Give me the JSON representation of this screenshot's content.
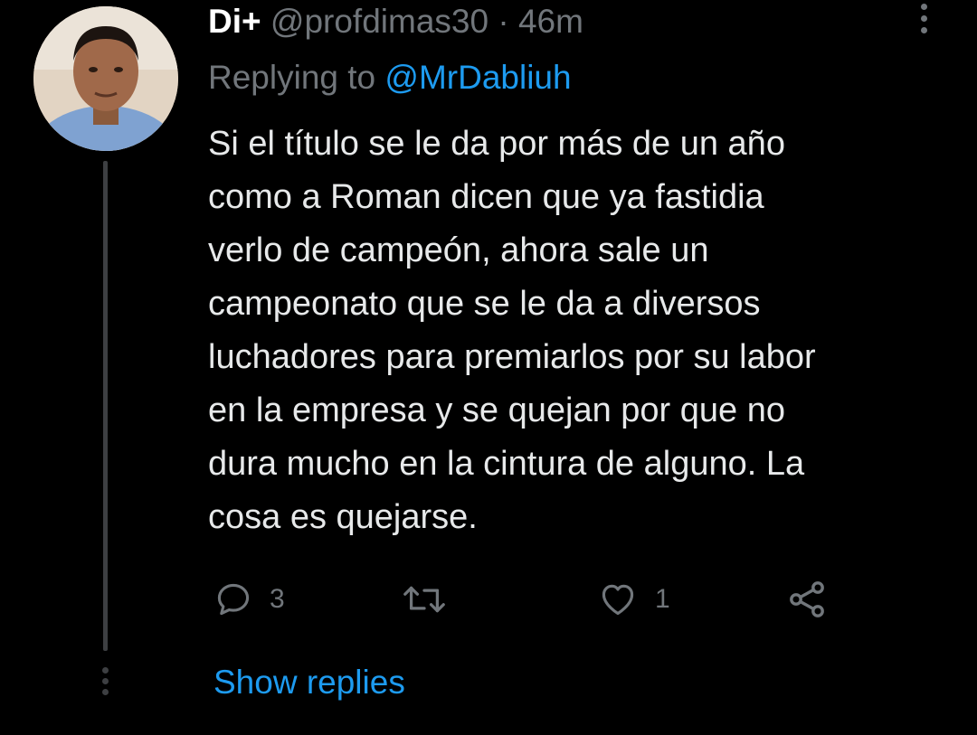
{
  "tweet": {
    "display_name": "Di+",
    "handle": "@profdimas30",
    "separator": "·",
    "time": "46m",
    "replying_prefix": "Replying to",
    "replying_to": "@MrDabliuh",
    "text_lines": [
      "Si el título se le da por más de un año",
      "como a Roman dicen que ya fastidia",
      "verlo de campeón, ahora sale un",
      "campeonato que se le da a diversos",
      "luchadores para premiarlos por su labor",
      "en la empresa y se quejan por que no",
      "dura mucho en la cintura de alguno. La",
      "cosa es quejarse."
    ],
    "actions": {
      "reply_count": "3",
      "retweet_count": "",
      "like_count": "1"
    },
    "show_replies_label": "Show replies",
    "icons": {
      "reply": "reply-icon",
      "retweet": "retweet-icon",
      "like": "heart-icon",
      "share": "share-icon",
      "more": "more-vertical-icon"
    },
    "colors": {
      "background": "#000000",
      "text": "#e7e9ea",
      "muted": "#71767b",
      "accent": "#1d9bf0"
    }
  }
}
